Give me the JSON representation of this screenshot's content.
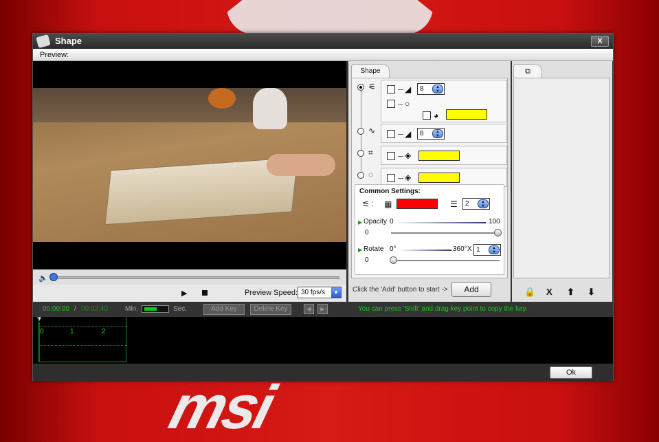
{
  "window": {
    "title": "Shape",
    "close_label": "X",
    "preview_label": "Preview:"
  },
  "player": {
    "speed_label": "Preview Speed:",
    "speed_value": "30 fps/s"
  },
  "shape_tab": {
    "label": "Shape"
  },
  "shapes": {
    "row1": {
      "size": "8",
      "fill_color": "#ffff00"
    },
    "row2": {
      "size": "8"
    },
    "row3": {
      "fill_color": "#ffff00"
    },
    "row4": {
      "fill_color": "#ffff00"
    }
  },
  "common": {
    "title": "Common Settings:",
    "colon": ":",
    "line_color": "#ff0000",
    "line_width": "2",
    "opacity_label": "Opacity",
    "opacity_min": "0",
    "opacity_max": "100",
    "opacity_value": "0",
    "rotate_label": "Rotate",
    "rotate_min": "0°",
    "rotate_max": "360°",
    "rotate_x": "X",
    "rotate_spin": "1",
    "rotate_value": "0"
  },
  "add": {
    "hint": "Click the 'Add' button to start ->",
    "button": "Add"
  },
  "layers": {
    "lock": "🔒",
    "delete": "X",
    "up": "⬆",
    "down": "⬇"
  },
  "timeline": {
    "current": "00:00:00",
    "sep": "/",
    "total": "00:02:40",
    "min_label": "Min.",
    "sec_label": "Sec.",
    "add_key": "Add Key",
    "delete_key": "Delete Key",
    "hint": "You can press 'Shift' and drag key point to copy the key.",
    "ticks": [
      "0",
      "1",
      "2"
    ]
  },
  "footer": {
    "ok": "Ok"
  },
  "background": {
    "brand": "msi"
  }
}
